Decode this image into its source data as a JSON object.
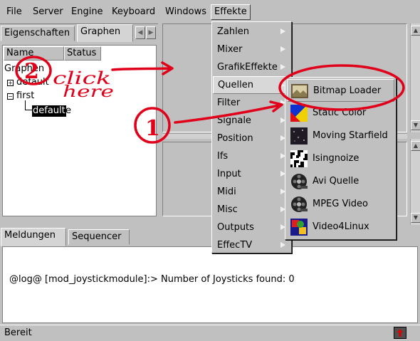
{
  "menubar": {
    "items": [
      "File",
      "Server",
      "Engine",
      "Keyboard",
      "Windows",
      "Effekte"
    ]
  },
  "left_tabs": [
    "Eigenschaften",
    "Graphen"
  ],
  "tree": {
    "columns": [
      "Name",
      "Status"
    ],
    "root": "Graphen",
    "items": [
      "default",
      "first"
    ],
    "selected_child": "default",
    "selected_child_tail": "e"
  },
  "bottom_tabs": [
    "Meldungen",
    "Sequencer"
  ],
  "log": {
    "line": "@log@ [mod_joystickmodule]:> Number of Joysticks found: 0"
  },
  "status": {
    "text": "Bereit"
  },
  "effekte_menu": {
    "items": [
      {
        "label": "Zahlen",
        "has_submenu": true
      },
      {
        "label": "Mixer",
        "has_submenu": true
      },
      {
        "label": "GrafikEffekte",
        "has_submenu": true
      },
      {
        "label": "Quellen",
        "has_submenu": true
      },
      {
        "label": "Filter",
        "has_submenu": true
      },
      {
        "label": "Signale",
        "has_submenu": true
      },
      {
        "label": "Position",
        "has_submenu": true
      },
      {
        "label": "Ifs",
        "has_submenu": true
      },
      {
        "label": "Input",
        "has_submenu": true
      },
      {
        "label": "Midi",
        "has_submenu": true
      },
      {
        "label": "Misc",
        "has_submenu": true
      },
      {
        "label": "Outputs",
        "has_submenu": true
      },
      {
        "label": "EffecTV",
        "has_submenu": true
      }
    ],
    "highlighted": "Quellen"
  },
  "quellen_menu": {
    "items": [
      {
        "label": "Bitmap Loader",
        "icon": "bitmap-icon"
      },
      {
        "label": "Static Color",
        "icon": "color-icon"
      },
      {
        "label": "Moving Starfield",
        "icon": "starfield-icon"
      },
      {
        "label": "Isingnoize",
        "icon": "noise-icon"
      },
      {
        "label": "Avi Quelle",
        "icon": "film-reel-icon"
      },
      {
        "label": "MPEG Video",
        "icon": "film-reel-icon"
      },
      {
        "label": "Video4Linux",
        "icon": "v4l-icon"
      }
    ],
    "highlighted": "Bitmap Loader"
  },
  "annotations": {
    "step_two": "2",
    "step_one": "1",
    "handwriting": "click here",
    "color": "#e0001a"
  }
}
